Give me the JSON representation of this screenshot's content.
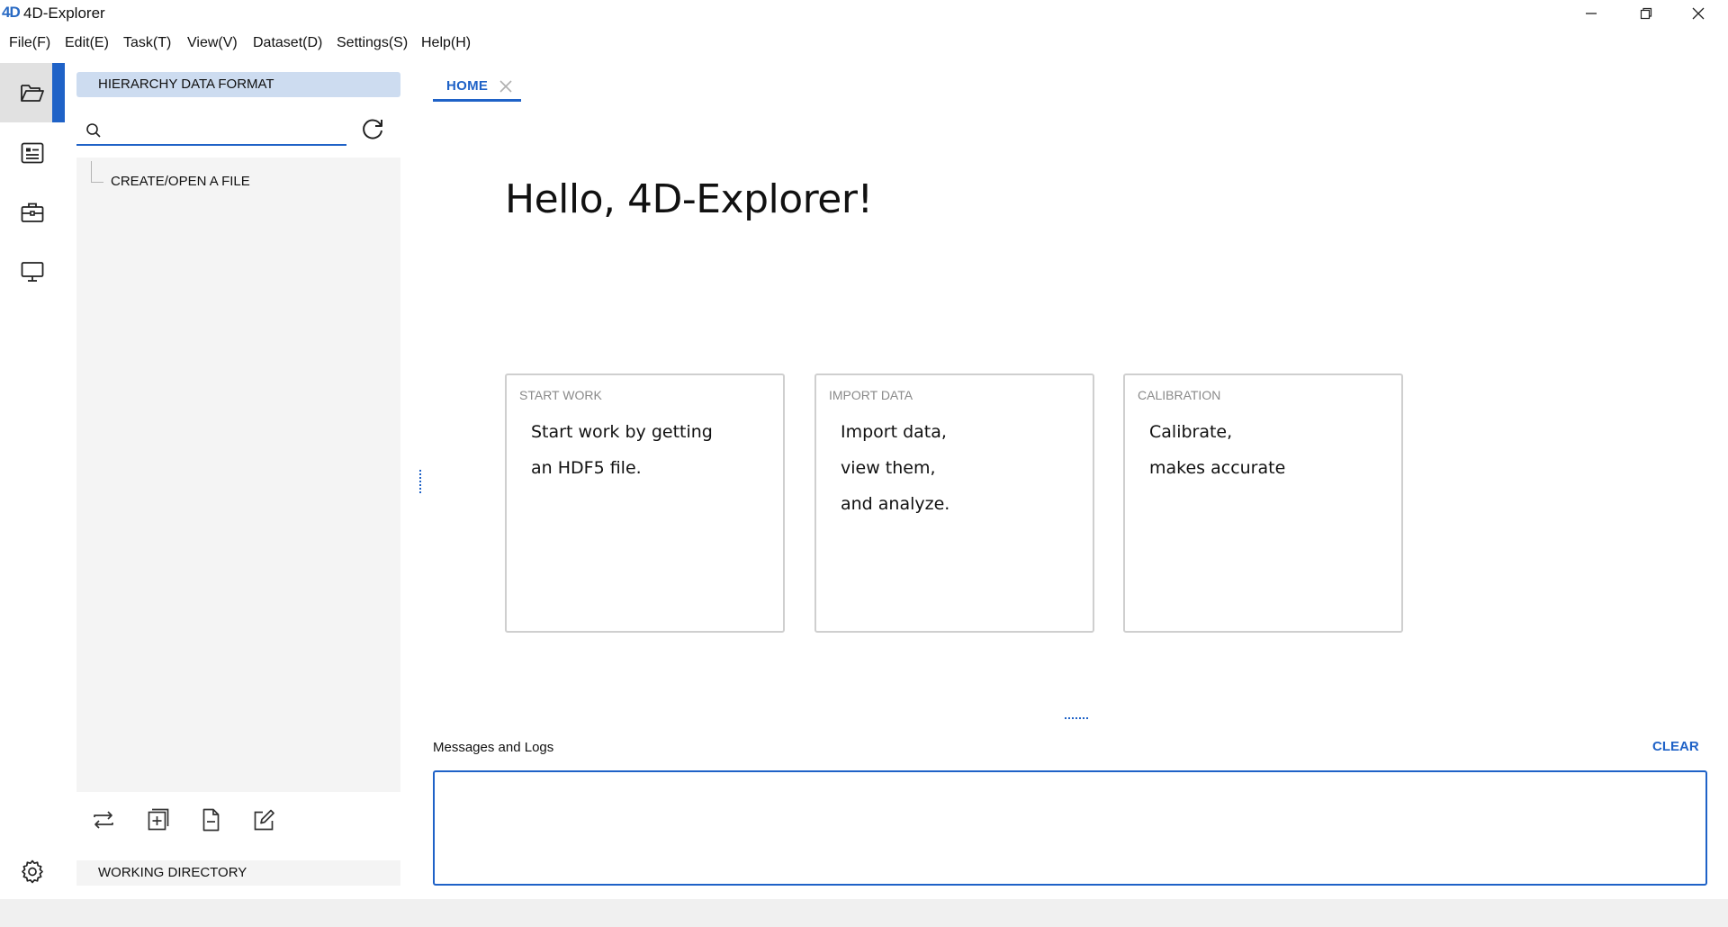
{
  "window": {
    "logo": "4D",
    "title": "4D-Explorer"
  },
  "menu": [
    "File(F)",
    "Edit(E)",
    "Task(T)",
    "View(V)",
    "Dataset(D)",
    "Settings(S)",
    "Help(H)"
  ],
  "activity_bar": {
    "items": [
      {
        "name": "explorer",
        "icon": "folder-open-icon",
        "active": true
      },
      {
        "name": "dataset",
        "icon": "list-card-icon",
        "active": false
      },
      {
        "name": "tasks",
        "icon": "briefcase-icon",
        "active": false
      },
      {
        "name": "display",
        "icon": "monitor-icon",
        "active": false
      }
    ],
    "settings_icon": "gear-icon"
  },
  "explorer": {
    "header": "HIERARCHY DATA FORMAT",
    "search": {
      "value": "",
      "placeholder": ""
    },
    "tree_items": [
      "CREATE/OPEN A FILE"
    ],
    "toolbar_icons": [
      "switch-icon",
      "add-file-icon",
      "remove-file-icon",
      "edit-icon"
    ],
    "working_directory_label": "WORKING DIRECTORY"
  },
  "tabs": [
    {
      "label": "HOME",
      "active": true
    }
  ],
  "home": {
    "greeting": "Hello, 4D-Explorer!",
    "cards": [
      {
        "title": "START WORK",
        "lines": [
          "Start work by getting",
          "an HDF5 file."
        ]
      },
      {
        "title": "IMPORT DATA",
        "lines": [
          "Import data,",
          "view them,",
          "and analyze."
        ]
      },
      {
        "title": "CALIBRATION",
        "lines": [
          "Calibrate,",
          "makes accurate"
        ]
      }
    ]
  },
  "messages": {
    "label": "Messages and Logs",
    "clear_label": "CLEAR",
    "content": ""
  },
  "colors": {
    "accent": "#1f62c7",
    "header_bg": "#cddcf0",
    "panel_bg": "#f4f4f4"
  }
}
